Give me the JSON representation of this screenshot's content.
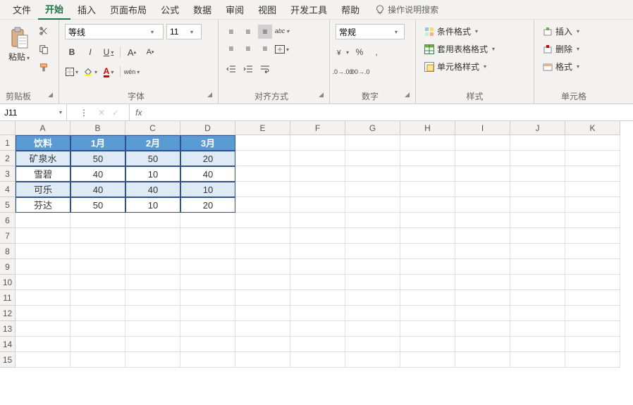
{
  "menu": {
    "items": [
      "文件",
      "开始",
      "插入",
      "页面布局",
      "公式",
      "数据",
      "审阅",
      "视图",
      "开发工具",
      "帮助"
    ],
    "active_index": 1,
    "tellme_label": "操作说明搜索"
  },
  "ribbon": {
    "clipboard": {
      "paste": "粘贴",
      "label": "剪贴板"
    },
    "font": {
      "name": "等线",
      "size": "11",
      "bold": "B",
      "italic": "I",
      "underline": "U",
      "phonetic": "wén",
      "label": "字体"
    },
    "alignment": {
      "label": "对齐方式",
      "orientation_hint": "abc"
    },
    "number": {
      "format": "常规",
      "label": "数字"
    },
    "styles": {
      "conditional": "条件格式",
      "table": "套用表格格式",
      "cell": "单元格样式",
      "label": "样式"
    },
    "cells": {
      "insert": "插入",
      "delete": "删除",
      "format": "格式",
      "label": "单元格"
    }
  },
  "namebox": "J11",
  "formula": "",
  "fx_label": "fx",
  "columns": [
    "A",
    "B",
    "C",
    "D",
    "E",
    "F",
    "G",
    "H",
    "I",
    "J",
    "K"
  ],
  "rows": [
    "1",
    "2",
    "3",
    "4",
    "5",
    "6",
    "7",
    "8",
    "9",
    "10",
    "11",
    "12",
    "13",
    "14",
    "15"
  ],
  "chart_data": {
    "type": "table",
    "header": [
      "饮料",
      "1月",
      "2月",
      "3月"
    ],
    "rows": [
      [
        "矿泉水",
        50,
        50,
        20
      ],
      [
        "雪碧",
        40,
        10,
        40
      ],
      [
        "可乐",
        40,
        40,
        10
      ],
      [
        "芬达",
        50,
        10,
        20
      ]
    ]
  }
}
